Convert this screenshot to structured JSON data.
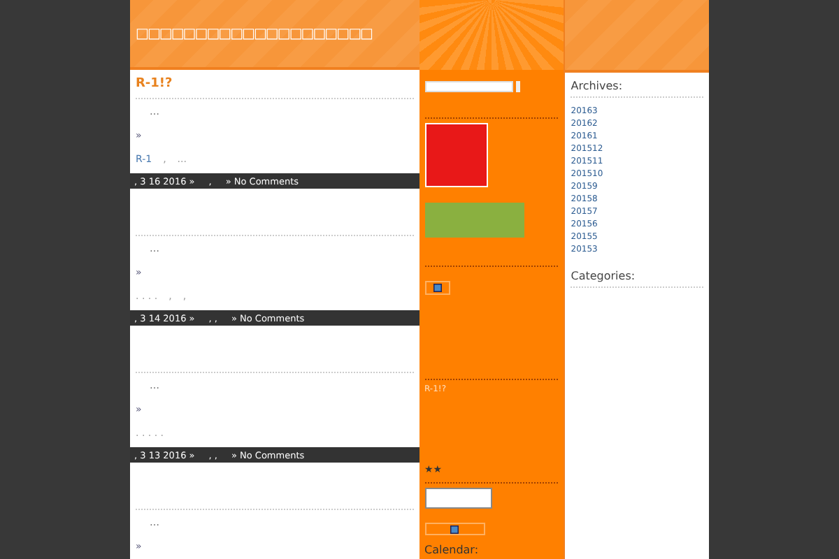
{
  "header": {
    "title": "□□□□□□□□□□□□□□□□□□□□"
  },
  "posts": [
    {
      "title": "R-1!?",
      "excerpt": "…",
      "more": "»",
      "meta": [
        {
          "text": "R-1",
          "kind": "link"
        },
        {
          "text": ",",
          "kind": "text"
        },
        {
          "text": "...",
          "kind": "text"
        }
      ],
      "footer": {
        "date": ", 3 16 2016 »",
        "sep": ",",
        "comments": "» No Comments"
      }
    },
    {
      "excerpt": "…",
      "more": "»",
      "meta": [
        {
          "text": ". . . .",
          "kind": "text"
        },
        {
          "text": ",",
          "kind": "text"
        },
        {
          "text": ",",
          "kind": "text"
        }
      ],
      "footer": {
        "date": ", 3 14 2016 »",
        "sep": ",   ,",
        "comments": "» No Comments"
      }
    },
    {
      "excerpt": "…",
      "more": "»",
      "meta": [
        {
          "text": ". . . . .",
          "kind": "text"
        }
      ],
      "footer": {
        "date": ", 3 13 2016 »",
        "sep": ",  ,",
        "comments": "» No Comments"
      }
    },
    {
      "excerpt": "…",
      "more": "»"
    }
  ],
  "middle": {
    "recent_post": "R-1!?",
    "stars": "★★",
    "calendar_heading": "Calendar:"
  },
  "archives": {
    "heading": "Archives:",
    "items": [
      "20163",
      "20162",
      "20161",
      "201512",
      "201511",
      "201510",
      "20159",
      "20158",
      "20157",
      "20156",
      "20155",
      "20153"
    ]
  },
  "categories": {
    "heading": "Categories:"
  }
}
